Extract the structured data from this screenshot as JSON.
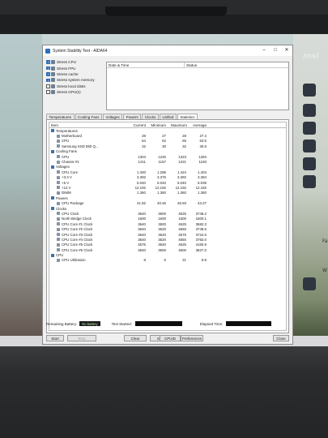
{
  "window": {
    "title": "System Stability Test - AIDA64",
    "controls": [
      "–",
      "□",
      "✕"
    ]
  },
  "brand": {
    "logo_text": "msi"
  },
  "stress_options": [
    {
      "label": "Stress CPU",
      "checked": true,
      "icon": "cpu-icon"
    },
    {
      "label": "Stress FPU",
      "checked": true,
      "icon": "fpu-icon"
    },
    {
      "label": "Stress cache",
      "checked": true,
      "icon": "cache-icon"
    },
    {
      "label": "Stress system memory",
      "checked": true,
      "icon": "memory-icon"
    },
    {
      "label": "Stress local disks",
      "checked": false,
      "icon": "disk-icon"
    },
    {
      "label": "Stress GPU(s)",
      "checked": false,
      "icon": "gpu-icon"
    }
  ],
  "log": {
    "col_datetime": "Date & Time",
    "col_status": "Status"
  },
  "tabs": [
    "Temperatures",
    "Cooling Fans",
    "Voltages",
    "Powers",
    "Clocks",
    "Unified",
    "Statistics"
  ],
  "active_tab": "Statistics",
  "stats": {
    "columns": [
      "Item",
      "Current",
      "Minimum",
      "Maximum",
      "Average"
    ],
    "rows": [
      {
        "level": 1,
        "name": "Temperatures",
        "values": [
          "",
          "",
          "",
          ""
        ]
      },
      {
        "level": 2,
        "name": "Motherboard",
        "values": [
          "28",
          "27",
          "28",
          "27.4"
        ]
      },
      {
        "level": 2,
        "name": "CPU",
        "values": [
          "64",
          "62",
          "65",
          "63.5"
        ]
      },
      {
        "level": 2,
        "name": "Samsung SSD 860 Q...",
        "values": [
          "32",
          "30",
          "32",
          "30.6"
        ]
      },
      {
        "level": 1,
        "name": "Cooling Fans",
        "values": [
          "",
          "",
          "",
          ""
        ]
      },
      {
        "level": 2,
        "name": "CPU",
        "values": [
          "1304",
          "1245",
          "1323",
          "1284"
        ]
      },
      {
        "level": 2,
        "name": "Chassis #1",
        "values": [
          "1211",
          "1157",
          "1221",
          "1193"
        ]
      },
      {
        "level": 1,
        "name": "Voltages",
        "values": [
          "",
          "",
          "",
          ""
        ]
      },
      {
        "level": 2,
        "name": "CPU Core",
        "values": [
          "1.400",
          "1.296",
          "1.424",
          "1.404"
        ]
      },
      {
        "level": 2,
        "name": "+3.3 V",
        "values": [
          "3.392",
          "3.376",
          "3.392",
          "3.384"
        ]
      },
      {
        "level": 2,
        "name": "+5 V",
        "values": [
          "5.040",
          "5.040",
          "5.040",
          "5.039"
        ]
      },
      {
        "level": 2,
        "name": "+12 V",
        "values": [
          "12.192",
          "12.192",
          "12.192",
          "12.192"
        ]
      },
      {
        "level": 2,
        "name": "DIMM",
        "values": [
          "1.360",
          "1.360",
          "1.360",
          "1.360"
        ]
      },
      {
        "level": 1,
        "name": "Powers",
        "values": [
          "",
          "",
          "",
          ""
        ]
      },
      {
        "level": 2,
        "name": "CPU Package",
        "values": [
          "41.82",
          "40.45",
          "46.93",
          "43.27"
        ]
      },
      {
        "level": 1,
        "name": "Clocks",
        "values": [
          "",
          "",
          "",
          ""
        ]
      },
      {
        "level": 2,
        "name": "CPU Clock",
        "values": [
          "3640",
          "3600",
          "4625",
          "3748.2"
        ]
      },
      {
        "level": 2,
        "name": "North Bridge Clock",
        "values": [
          "1600",
          "1600",
          "1600",
          "1600.1"
        ]
      },
      {
        "level": 2,
        "name": "CPU Core #1 Clock",
        "values": [
          "3640",
          "3600",
          "4625",
          "3682.3"
        ]
      },
      {
        "level": 2,
        "name": "CPU Core #2 Clock",
        "values": [
          "3640",
          "3620",
          "4650",
          "3748.6"
        ]
      },
      {
        "level": 2,
        "name": "CPU Core #3 Clock",
        "values": [
          "3640",
          "3620",
          "4575",
          "3722.6"
        ]
      },
      {
        "level": 2,
        "name": "CPU Core #4 Clock",
        "values": [
          "3640",
          "3620",
          "4650",
          "3792.0"
        ]
      },
      {
        "level": 2,
        "name": "CPU Core #5 Clock",
        "values": [
          "4575",
          "3640",
          "4625",
          "4160.9"
        ]
      },
      {
        "level": 2,
        "name": "CPU Core #6 Clock",
        "values": [
          "3640",
          "3600",
          "4600",
          "3827.0"
        ]
      },
      {
        "level": 1,
        "name": "CPU",
        "values": [
          "",
          "",
          "",
          ""
        ]
      },
      {
        "level": 2,
        "name": "CPU Utilization",
        "values": [
          "8",
          "6",
          "21",
          "9.8"
        ]
      }
    ]
  },
  "status_bar": {
    "battery_label": "Remaining Battery:",
    "battery_value": "No battery",
    "test_started_label": "Test Started:",
    "elapsed_label": "Elapsed Time:"
  },
  "buttons": {
    "start": "Start",
    "stop": "Stop",
    "clear": "Clear",
    "save": "Save",
    "cpuid": "CPUID",
    "preferences": "Preferences",
    "close": "Close"
  },
  "desktop_side_text": {
    "top": "Fa",
    "bottom": "W"
  }
}
